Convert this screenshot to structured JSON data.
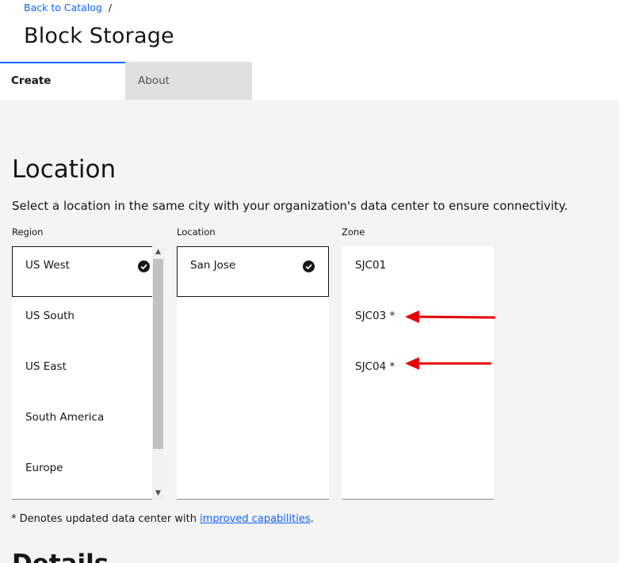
{
  "breadcrumb": {
    "link": "Back to Catalog",
    "separator": "/"
  },
  "page_title": "Block Storage",
  "tabs": [
    {
      "label": "Create",
      "active": true
    },
    {
      "label": "About",
      "active": false
    }
  ],
  "location": {
    "title": "Location",
    "description": "Select a location in the same city with your organization's data center to ensure connectivity.",
    "region_label": "Region",
    "location_label": "Location",
    "zone_label": "Zone",
    "regions": [
      "US West",
      "US South",
      "US East",
      "South America",
      "Europe"
    ],
    "selected_region": "US West",
    "locations": [
      "San Jose"
    ],
    "selected_location": "San Jose",
    "zones": [
      "SJC01",
      "SJC03 *",
      "SJC04 *"
    ]
  },
  "footnote": {
    "prefix": "* Denotes updated data center with ",
    "link": "improved capabilities",
    "suffix": "."
  },
  "next_section_title": "Details",
  "colors": {
    "accent": "#0f62fe",
    "annotation_arrow": "#e60000"
  },
  "icons": {
    "selected": "checkmark-filled-icon",
    "scroll_up": "chevron-up-icon",
    "scroll_down": "chevron-down-icon"
  }
}
